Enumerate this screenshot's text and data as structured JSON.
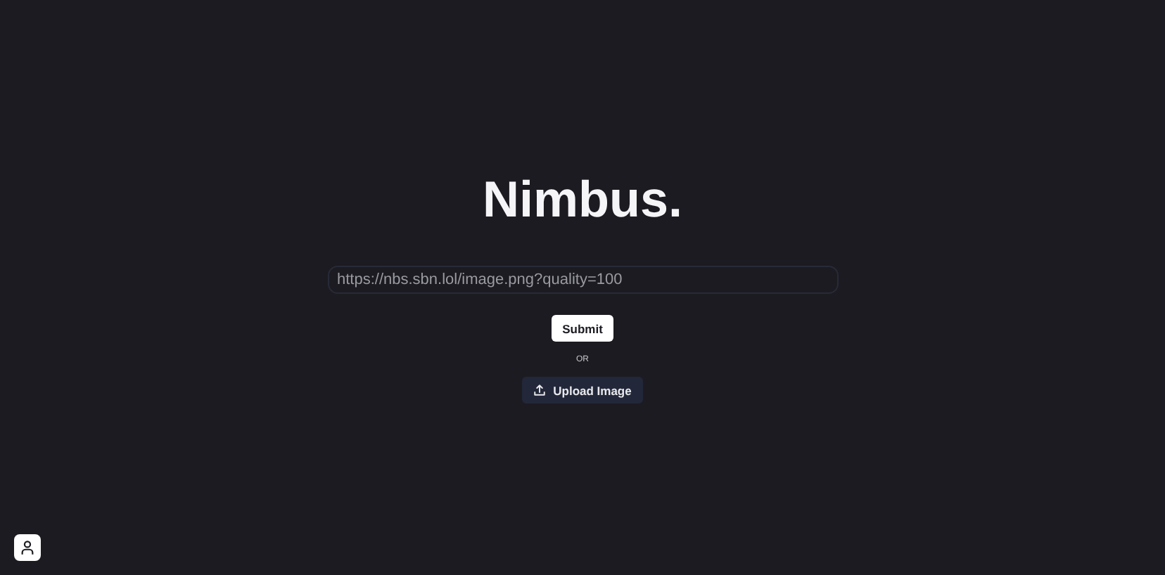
{
  "title": "Nimbus.",
  "url_field": {
    "placeholder": "https://nbs.sbn.lol/image.png?quality=100"
  },
  "submit_button": "Submit",
  "divider_text": "OR",
  "upload_button": "Upload Image"
}
